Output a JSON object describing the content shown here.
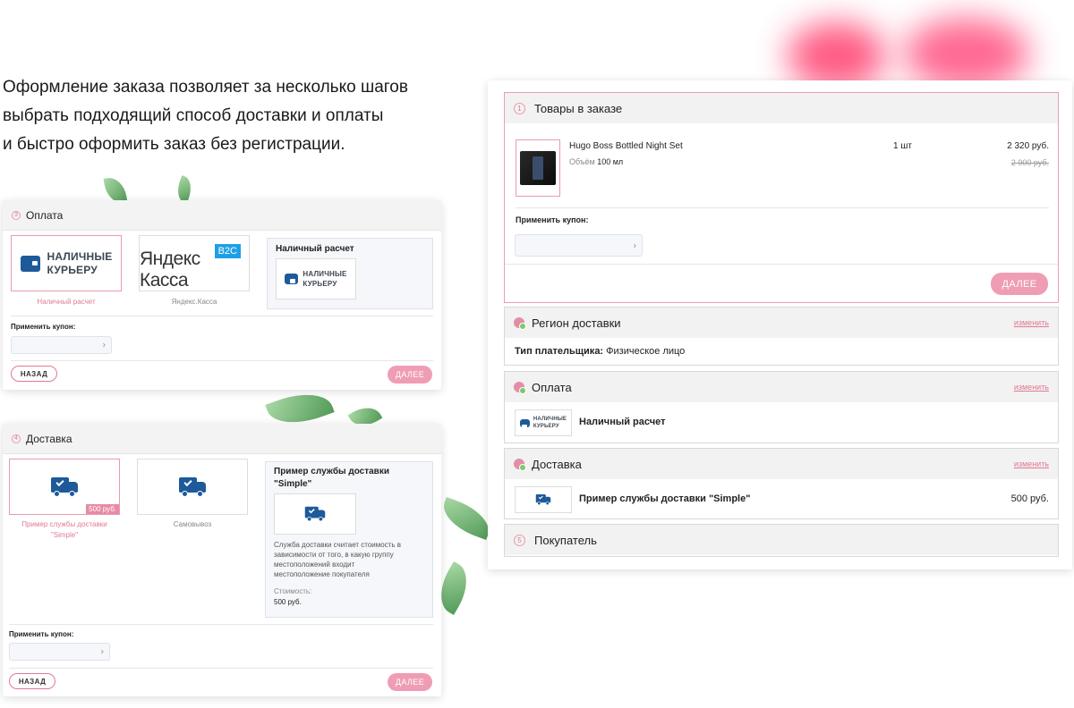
{
  "intro": {
    "line1": "Оформление заказа позволяет за несколько шагов",
    "line2": "выбрать подходящий способ доставки и оплаты",
    "line3": "и быстро оформить заказ без регистрации."
  },
  "payment_card": {
    "step": "3",
    "title": "Оплата",
    "option1": {
      "logo_line1": "НАЛИЧНЫЕ",
      "logo_line2": "КУРЬЕРУ",
      "caption": "Наличный расчет"
    },
    "option2": {
      "logo_text": "Яндекс Касса",
      "badge": "B2C",
      "caption": "Яндекс.Касса"
    },
    "detail": {
      "title": "Наличный расчет",
      "logo_line1": "НАЛИЧНЫЕ",
      "logo_line2": "КУРЬЕРУ"
    },
    "coupon_label": "Применить купон:",
    "coupon_value": "",
    "back_label": "НАЗАД",
    "next_label": "ДАЛЕЕ"
  },
  "delivery_card": {
    "step": "4",
    "title": "Доставка",
    "option1": {
      "price_badge": "500 руб.",
      "caption_line1": "Пример службы доставки",
      "caption_line2": "\"Simple\""
    },
    "option2": {
      "caption": "Самовывоз"
    },
    "detail": {
      "title_line1": "Пример службы доставки",
      "title_line2": "\"Simple\"",
      "desc_line1": "Служба доставки считает стоимость в",
      "desc_line2": "зависимости от того, в какую группу",
      "desc_line3": "местоположений входит",
      "desc_line4": "местоположение покупателя",
      "cost_label": "Стоимость:",
      "cost_value": "500 руб."
    },
    "coupon_label": "Применить купон:",
    "coupon_value": "",
    "back_label": "НАЗАД",
    "next_label": "ДАЛЕЕ"
  },
  "order_panel": {
    "items_section": {
      "step": "1",
      "title": "Товары в заказе",
      "product": {
        "name": "Hugo Boss Bottled Night Set",
        "volume_label": "Объём",
        "volume_value": "100 мл",
        "qty": "1 шт",
        "price": "2 320 руб.",
        "old_price": "2 900 руб."
      },
      "coupon_label": "Применить купон:",
      "coupon_value": "",
      "next_label": "ДАЛЕЕ"
    },
    "region_section": {
      "title": "Регион доставки",
      "change_label": "изменить",
      "payer_label": "Тип плательщика:",
      "payer_value": "Физическое лицо"
    },
    "payment_section": {
      "title": "Оплата",
      "change_label": "изменить",
      "logo_line1": "НАЛИЧНЫЕ",
      "logo_line2": "КУРЬЕРУ",
      "method": "Наличный расчет"
    },
    "delivery_section": {
      "title": "Доставка",
      "change_label": "изменить",
      "service": "Пример службы доставки \"Simple\"",
      "price": "500 руб."
    },
    "buyer_section": {
      "step": "5",
      "title": "Покупатель"
    }
  },
  "colors": {
    "accent_pink": "#e07a92",
    "button_pink": "#ef9db4",
    "brand_blue": "#1d5a9a",
    "ok_green": "#7bc96f"
  }
}
